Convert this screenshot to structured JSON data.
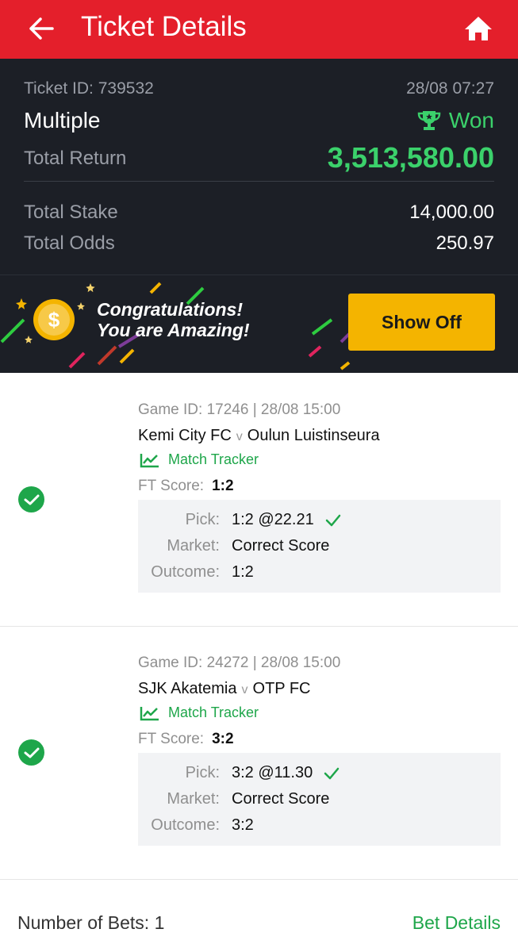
{
  "header": {
    "title": "Ticket Details",
    "back_icon": "arrow-left-icon",
    "home_icon": "home-icon",
    "color": "#e41f2b"
  },
  "ticket": {
    "id_label": "Ticket ID: 739532",
    "datetime": "28/08 07:27",
    "type": "Multiple",
    "status": "Won",
    "status_icon": "trophy-icon",
    "total_return_label": "Total Return",
    "total_return": "3,513,580.00",
    "total_stake_label": "Total Stake",
    "total_stake": "14,000.00",
    "total_odds_label": "Total Odds",
    "total_odds": "250.97",
    "win_color": "#3bd16b"
  },
  "banner": {
    "line1": "Congratulations!",
    "line2": "You are Amazing!",
    "button_label": "Show Off",
    "button_color": "#f4b400"
  },
  "bets": [
    {
      "game_id": "Game ID: 17246 | 28/08 15:00",
      "home": "Kemi City FC",
      "vs": "v",
      "away": "Oulun Luistinseura",
      "tracker_label": "Match Tracker",
      "ft_label": "FT Score:",
      "ft_score": "1:2",
      "pick_label": "Pick:",
      "pick": "1:2 @22.21",
      "market_label": "Market:",
      "market": "Correct Score",
      "outcome_label": "Outcome:",
      "outcome": "1:2"
    },
    {
      "game_id": "Game ID: 24272 | 28/08 15:00",
      "home": "SJK Akatemia",
      "vs": "v",
      "away": "OTP FC",
      "tracker_label": "Match Tracker",
      "ft_label": "FT Score:",
      "ft_score": "3:2",
      "pick_label": "Pick:",
      "pick": "3:2 @11.30",
      "market_label": "Market:",
      "market": "Correct Score",
      "outcome_label": "Outcome:",
      "outcome": "3:2"
    }
  ],
  "footer": {
    "bets_count": "Number of Bets: 1",
    "bet_details_link": "Bet Details"
  }
}
